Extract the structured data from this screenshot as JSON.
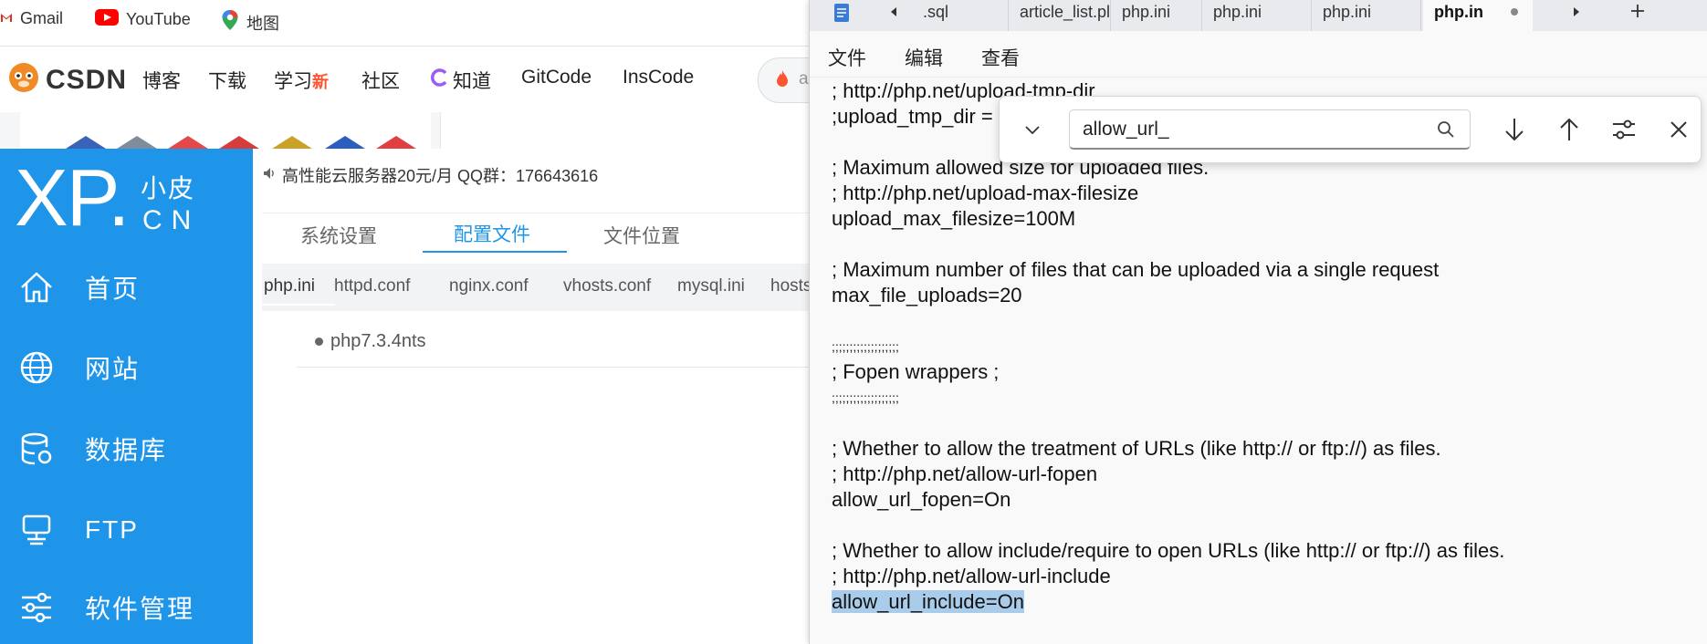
{
  "bookmarks": {
    "gmail": "Gmail",
    "youtube": "YouTube",
    "maps": "地图"
  },
  "csdn": {
    "logo": "CSDN",
    "nav": [
      "博客",
      "下载",
      "学习",
      "社区",
      "知道",
      "GitCode",
      "InsCode"
    ],
    "badge_new": "新",
    "search_partial": "a"
  },
  "xp": {
    "logo_big": "XP.",
    "logo_small_top": "小皮",
    "logo_small_bottom": "CN",
    "announcement": "高性能云服务器20元/月  QQ群：176643616",
    "menu": [
      "首页",
      "网站",
      "数据库",
      "FTP",
      "软件管理"
    ],
    "tabs": [
      "系统设置",
      "配置文件",
      "文件位置"
    ],
    "active_tab": "配置文件",
    "file_tabs": [
      "php.ini",
      "httpd.conf",
      "nginx.conf",
      "vhosts.conf",
      "mysql.ini",
      "hosts"
    ],
    "php_version": "php7.3.4nts",
    "accent": "#1f95ea"
  },
  "notepad": {
    "tabs": [
      ".sql",
      "article_list.pl",
      "php.ini",
      "php.ini",
      "php.ini",
      "php.in"
    ],
    "active_tab": "php.in",
    "menu": [
      "文件",
      "编辑",
      "查看"
    ],
    "search_value": "allow_url_",
    "lines": [
      "; http://php.net/upload-tmp-dir",
      ";upload_tmp_dir =",
      "",
      "; Maximum allowed size for uploaded files.",
      "; http://php.net/upload-max-filesize",
      "upload_max_filesize=100M",
      "",
      "; Maximum number of files that can be uploaded via a single request",
      "max_file_uploads=20",
      "",
      ";;;;;;;;;;;;;;;;;;;",
      "; Fopen wrappers ;",
      ";;;;;;;;;;;;;;;;;;;",
      "",
      "; Whether to allow the treatment of URLs (like http:// or ftp://) as files.",
      "; http://php.net/allow-url-fopen",
      "allow_url_fopen=On",
      "",
      "; Whether to allow include/require to open URLs (like http:// or ftp://) as files.",
      "; http://php.net/allow-url-include",
      "allow_url_include=On"
    ]
  }
}
